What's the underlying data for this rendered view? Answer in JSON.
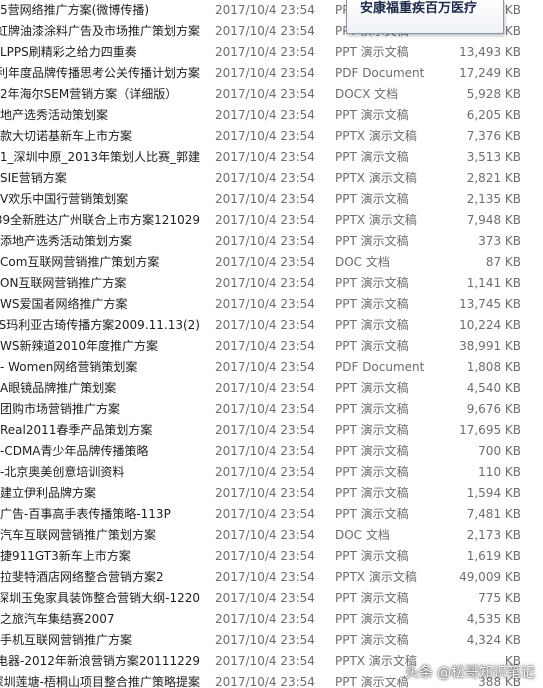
{
  "tooltip": {
    "text": "安康福重疾百万医疗"
  },
  "watermark": {
    "prefix": "头条",
    "handle": "@松哥知识笔记"
  },
  "rows": [
    {
      "name": "5营网络推广方案(微博传播)",
      "date": "2017/10/4 23:54",
      "type": "PPT 演示文稿",
      "size": "KB"
    },
    {
      "name": "4年虹牌油漆涂料广告及市场推广策划方案",
      "date": "2017/10/4 23:54",
      "type": "PPT 演示文稿",
      "size": "KB"
    },
    {
      "name": "LPPS刷精彩之给力四重奏",
      "date": "2017/10/4 23:54",
      "type": "PPT 演示文稿",
      "size": "13,493 KB"
    },
    {
      "name": "吉利年度品牌传播思考公关传播计划方案",
      "date": "2017/10/4 23:54",
      "type": "PDF Document",
      "size": "17,249 KB"
    },
    {
      "name": "2年海尔SEM营销方案（详细版）",
      "date": "2017/10/4 23:54",
      "type": "DOCX 文档",
      "size": "5,928 KB"
    },
    {
      "name": "地产选秀活动策划案",
      "date": "2017/10/4 23:54",
      "type": "PPT 演示文稿",
      "size": "6,205 KB"
    },
    {
      "name": "款大切诺基新车上市方案",
      "date": "2017/10/4 23:54",
      "type": "PPTX 演示文稿",
      "size": "7,376 KB"
    },
    {
      "name": "801_深圳中原_2013年策划人比赛_郭建",
      "date": "2017/10/4 23:54",
      "type": "PPT 演示文稿",
      "size": "3,513 KB"
    },
    {
      "name": "SIE营销方案",
      "date": "2017/10/4 23:54",
      "type": "PPTX 演示文稿",
      "size": "2,821 KB"
    },
    {
      "name": "V欢乐中国行营销策划案",
      "date": "2017/10/4 23:54",
      "type": "PPT 演示文稿",
      "size": "2,135 KB"
    },
    {
      "name": "39全新胜达广州联合上市方案121029",
      "date": "2017/10/4 23:54",
      "type": "PPTX 演示文稿",
      "size": "7,948 KB"
    },
    {
      "name": "添地产选秀活动策划方案",
      "date": "2017/10/4 23:54",
      "type": "PPT 演示文稿",
      "size": "373 KB"
    },
    {
      "name": "Com互联网营销推广策划方案",
      "date": "2017/10/4 23:54",
      "type": "DOC 文档",
      "size": "87 KB"
    },
    {
      "name": "ON互联网营销推广方案",
      "date": "2017/10/4 23:54",
      "type": "PPT 演示文稿",
      "size": "1,141 KB"
    },
    {
      "name": "WS爱国者网络推广方案",
      "date": "2017/10/4 23:54",
      "type": "PPT 演示文稿",
      "size": "13,745 KB"
    },
    {
      "name": "WS玛利亚古琦传播方案2009.11.13(2)",
      "date": "2017/10/4 23:54",
      "type": "PPT 演示文稿",
      "size": "10,224 KB"
    },
    {
      "name": "WS新辣道2010年度推广方案",
      "date": "2017/10/4 23:54",
      "type": "PPT 演示文稿",
      "size": "38,991 KB"
    },
    {
      "name": "- Women网络营销策划案",
      "date": "2017/10/4 23:54",
      "type": "PDF Document",
      "size": "1,808 KB"
    },
    {
      "name": "A眼镜品牌推广策划案",
      "date": "2017/10/4 23:54",
      "type": "PPT 演示文稿",
      "size": "4,540 KB"
    },
    {
      "name": "团购市场营销推广方案",
      "date": "2017/10/4 23:54",
      "type": "PPT 演示文稿",
      "size": "9,676 KB"
    },
    {
      "name": "Real2011春季产品策划方案",
      "date": "2017/10/4 23:54",
      "type": "PPT 演示文稿",
      "size": "17,695 KB"
    },
    {
      "name": "-CDMA青少年品牌传播策略",
      "date": "2017/10/4 23:54",
      "type": "PPT 演示文稿",
      "size": "700 KB"
    },
    {
      "name": "-北京奥美创意培训资料",
      "date": "2017/10/4 23:54",
      "type": "PPT 演示文稿",
      "size": "110 KB"
    },
    {
      "name": "建立伊利品牌方案",
      "date": "2017/10/4 23:54",
      "type": "PPT 演示文稿",
      "size": "1,594 KB"
    },
    {
      "name": "广告-百事高手表传播策略-113P",
      "date": "2017/10/4 23:54",
      "type": "PPT 演示文稿",
      "size": "7,481 KB"
    },
    {
      "name": "汽车互联网营销推广策划方案",
      "date": "2017/10/4 23:54",
      "type": "DOC 文档",
      "size": "2,173 KB"
    },
    {
      "name": "捷911GT3新车上市方案",
      "date": "2017/10/4 23:54",
      "type": "PPT 演示文稿",
      "size": "1,619 KB"
    },
    {
      "name": "拉斐特酒店网络整合营销方案2",
      "date": "2017/10/4 23:54",
      "type": "PPTX 演示文稿",
      "size": "49,009 KB"
    },
    {
      "name": "-深圳玉兔家具装饰整合营销大纲-1220",
      "date": "2017/10/4 23:54",
      "type": "PPT 演示文稿",
      "size": "775 KB"
    },
    {
      "name": "之旅汽车集结赛2007",
      "date": "2017/10/4 23:54",
      "type": "PPT 演示文稿",
      "size": "4,535 KB"
    },
    {
      "name": "手机互联网营销推广方案",
      "date": "2017/10/4 23:54",
      "type": "PPT 演示文稿",
      "size": "4,324 KB"
    },
    {
      "name": "电器-2012年新浪营销方案20111229",
      "date": "2017/10/4 23:54",
      "type": "PPTX 演示文稿",
      "size": "KB"
    },
    {
      "name": "-深圳莲塘-梧桐山项目整合推广策略提案",
      "date": "2017/10/4 23:54",
      "type": "PPT 演示文稿",
      "size": "388 KB"
    }
  ]
}
